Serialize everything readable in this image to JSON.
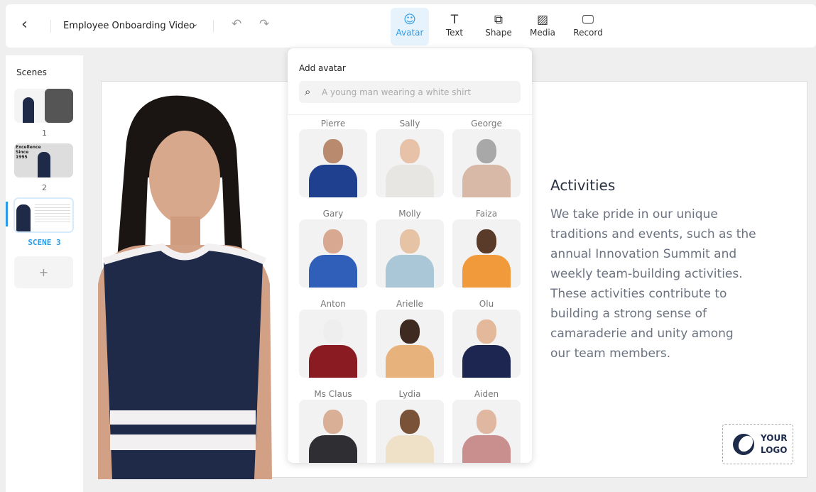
{
  "header": {
    "title": "Employee Onboarding Video",
    "tools": [
      {
        "label": "Avatar",
        "icon": "avatar-icon",
        "glyph": "☺",
        "active": true
      },
      {
        "label": "Text",
        "icon": "text-icon",
        "glyph": "T"
      },
      {
        "label": "Shape",
        "icon": "shape-icon",
        "glyph": "⧉"
      },
      {
        "label": "Media",
        "icon": "media-icon",
        "glyph": "▨"
      },
      {
        "label": "Record",
        "icon": "record-icon",
        "glyph": "🖵"
      }
    ]
  },
  "sidebar": {
    "title": "Scenes",
    "scenes": [
      {
        "label": "1"
      },
      {
        "label": "2",
        "text": "Excellence Since 1995"
      },
      {
        "label": "SCENE 3",
        "active": true
      }
    ],
    "add_label": "+"
  },
  "canvas": {
    "heading": "Activities",
    "body": "We take pride in our unique traditions and events, such as the annual Innovation Summit and weekly team-building activities. These activities contribute to building a strong sense of camaraderie and unity among our team members.",
    "logo": "YOUR LOGO"
  },
  "avatar_panel": {
    "title": "Add avatar",
    "search_placeholder": "A young man wearing a white shirt",
    "avatars": [
      {
        "name": "Pierre",
        "skin": "#b98a6e",
        "cloth": "#1f3f8f"
      },
      {
        "name": "Sally",
        "skin": "#e8c2a8",
        "cloth": "#e8e6e2"
      },
      {
        "name": "George",
        "skin": "#a8a8a8",
        "cloth": "#d8b8a6"
      },
      {
        "name": "Gary",
        "skin": "#d9a890",
        "cloth": "#2f5fb8"
      },
      {
        "name": "Molly",
        "skin": "#e6c3a5",
        "cloth": "#a9c7d6"
      },
      {
        "name": "Faiza",
        "skin": "#5a3a28",
        "cloth": "#f09a3c"
      },
      {
        "name": "Anton",
        "skin": "#eee",
        "cloth": "#8a1b22"
      },
      {
        "name": "Arielle",
        "skin": "#3e2a20",
        "cloth": "#e8b27c"
      },
      {
        "name": "Olu",
        "skin": "#e4b89a",
        "cloth": "#1d2650"
      },
      {
        "name": "Ms Claus",
        "skin": "#d9b096",
        "cloth": "#2e2e33"
      },
      {
        "name": "Lydia",
        "skin": "#7a5238",
        "cloth": "#efe0c8"
      },
      {
        "name": "Aiden",
        "skin": "#e0b7a0",
        "cloth": "#c98e8e"
      }
    ]
  },
  "colors": {
    "accent": "#2b9be8",
    "text_body": "#6b7280",
    "logo": "#1d2b4a"
  }
}
